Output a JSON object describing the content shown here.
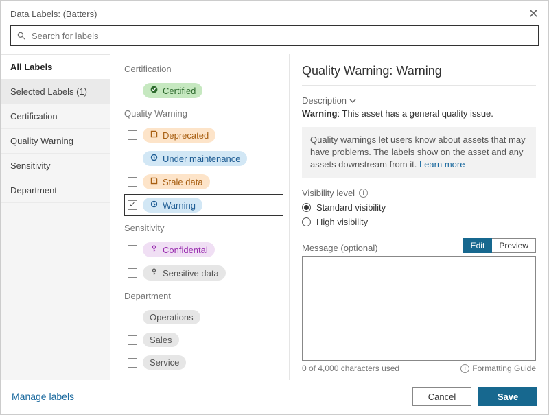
{
  "title": "Data Labels: (Batters)",
  "search": {
    "placeholder": "Search for labels"
  },
  "sidebar": [
    {
      "key": "all",
      "label": "All Labels",
      "active": true
    },
    {
      "key": "selected",
      "label": "Selected Labels (1)",
      "sel": true
    },
    {
      "key": "cert",
      "label": "Certification"
    },
    {
      "key": "qw",
      "label": "Quality Warning"
    },
    {
      "key": "sens",
      "label": "Sensitivity"
    },
    {
      "key": "dept",
      "label": "Department"
    }
  ],
  "categories": [
    {
      "name": "Certification",
      "items": [
        {
          "label": "Certified",
          "style": "green",
          "icon": "check-badge",
          "checked": false
        }
      ]
    },
    {
      "name": "Quality Warning",
      "items": [
        {
          "label": "Deprecated",
          "style": "orange",
          "icon": "warn",
          "checked": false
        },
        {
          "label": "Under maintenance",
          "style": "blue",
          "icon": "wrench",
          "checked": false
        },
        {
          "label": "Stale data",
          "style": "orange",
          "icon": "warn",
          "checked": false
        },
        {
          "label": "Warning",
          "style": "blue",
          "icon": "wrench",
          "checked": true,
          "selected": true
        }
      ]
    },
    {
      "name": "Sensitivity",
      "items": [
        {
          "label": "Confidental",
          "style": "purple",
          "icon": "key",
          "checked": false
        },
        {
          "label": "Sensitive data",
          "style": "gray",
          "icon": "key",
          "checked": false
        }
      ]
    },
    {
      "name": "Department",
      "items": [
        {
          "label": "Operations",
          "style": "gray",
          "icon": "",
          "checked": false
        },
        {
          "label": "Sales",
          "style": "gray",
          "icon": "",
          "checked": false
        },
        {
          "label": "Service",
          "style": "gray",
          "icon": "",
          "checked": false
        }
      ]
    }
  ],
  "detail": {
    "heading": "Quality Warning: Warning",
    "desc_label": "Description",
    "desc_bold": "Warning",
    "desc_text": ": This asset has a general quality issue.",
    "info_text": "Quality warnings let users know about assets that may have problems. The labels show on the asset and any assets downstream from it. ",
    "learn_more": "Learn more",
    "vis_label": "Visibility level",
    "vis_opts": [
      "Standard visibility",
      "High visibility"
    ],
    "vis_selected": 0,
    "msg_label": "Message (optional)",
    "tab_edit": "Edit",
    "tab_preview": "Preview",
    "char_counter": "0 of 4,000 characters used",
    "fguide": "Formatting Guide"
  },
  "footer": {
    "manage": "Manage labels",
    "cancel": "Cancel",
    "save": "Save"
  }
}
